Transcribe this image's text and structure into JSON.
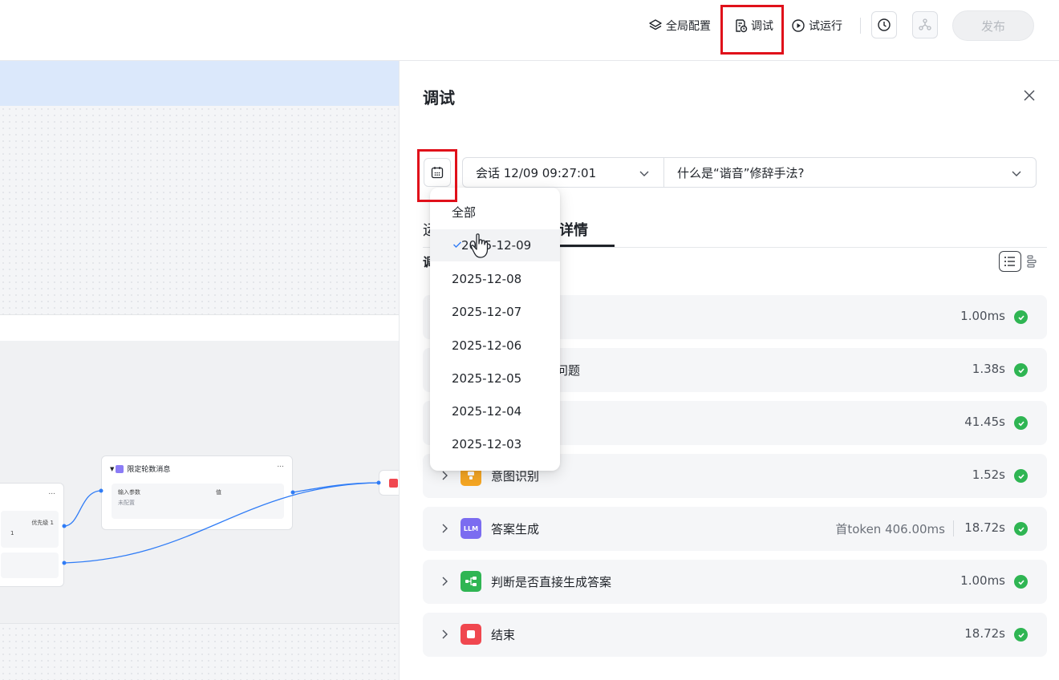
{
  "toolbar": {
    "global_config_label": "全局配置",
    "debug_label": "调试",
    "trial_run_label": "试运行",
    "publish_label": "发布"
  },
  "canvas": {
    "node_title": "限定轮数消息",
    "node_dots": "...",
    "input_params_label": "输入参数",
    "value_label": "值",
    "unconfigured_label": "未配置",
    "left_node_dots": "...",
    "priority_label": "优先级 1",
    "left_row_value": "1"
  },
  "panel": {
    "title": "调试",
    "session_select": "会话 12/09 09:27:01",
    "question_select": "什么是“谐音”修辞手法?",
    "tab_run_partial": "运",
    "tab_details": "详情",
    "sub_label_partial": "调"
  },
  "date_dropdown": {
    "options": [
      "全部",
      "2025-12-09",
      "2025-12-08",
      "2025-12-07",
      "2025-12-06",
      "2025-12-05",
      "2025-12-04",
      "2025-12-03"
    ],
    "selected_index": 1
  },
  "trace_rows": [
    {
      "label": "",
      "time": "1.00ms",
      "icon": "none",
      "color": ""
    },
    {
      "label": "语文问题",
      "time": "1.38s",
      "icon": "none",
      "color": ""
    },
    {
      "label": "",
      "time": "41.45s",
      "icon": "none",
      "color": ""
    },
    {
      "label": "意图识别",
      "time": "1.52s",
      "icon": "intent-icon",
      "color": "#f5a623"
    },
    {
      "label": "答案生成",
      "time": "18.72s",
      "first_token": "首token 406.00ms",
      "icon": "llm-icon",
      "icon_text": "LLM",
      "color": "#7b6cf0"
    },
    {
      "label": "判断是否直接生成答案",
      "time": "1.00ms",
      "icon": "branch-icon",
      "color": "#2fb553"
    },
    {
      "label": "结束",
      "time": "18.72s",
      "icon": "end-icon",
      "color": "#f0474f"
    }
  ],
  "colors": {
    "highlight_red": "#e0101a",
    "success_green": "#2fb553",
    "canvas_banner": "#dbe8fb",
    "edge_blue": "#2f7cf6"
  }
}
